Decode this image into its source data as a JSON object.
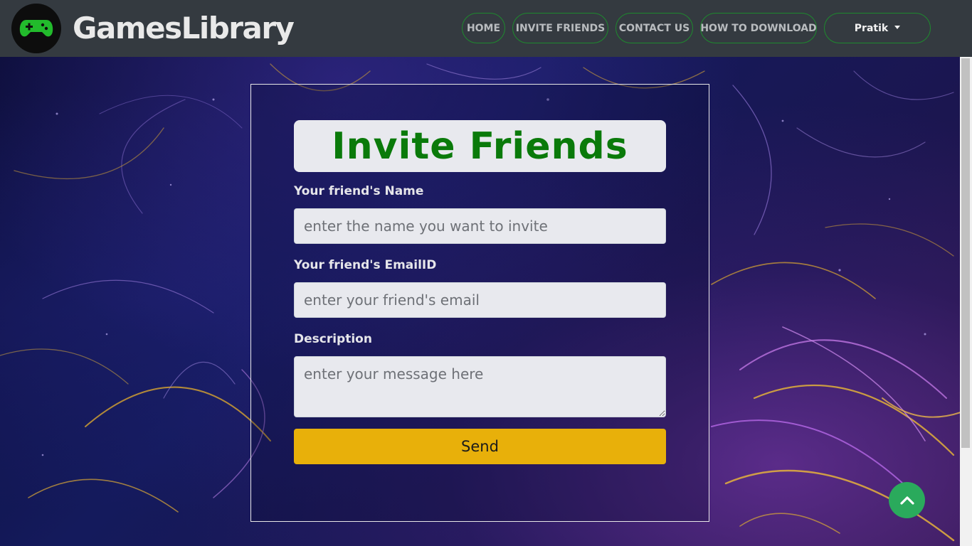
{
  "navbar": {
    "brand": "GamesLibrary",
    "logo_icon": "gamepad-icon",
    "items": [
      {
        "label": "HOME"
      },
      {
        "label": "INVITE FRIENDS"
      },
      {
        "label": "CONTACT US"
      },
      {
        "label": "HOW TO DOWNLOAD"
      }
    ],
    "user": {
      "label": "Pratik",
      "icon": "caret-down-icon"
    }
  },
  "form": {
    "title": "Invite Friends",
    "name": {
      "label": "Your friend's Name",
      "placeholder": "enter the name you want to invite",
      "value": ""
    },
    "email": {
      "label": "Your friend's EmailID",
      "placeholder": "enter your friend's email",
      "value": ""
    },
    "description": {
      "label": "Description",
      "placeholder": "enter your message here",
      "value": ""
    },
    "submit_label": "Send"
  },
  "scroll_top": {
    "icon": "chevron-up-icon"
  },
  "colors": {
    "navbar_bg": "#343a40",
    "nav_border": "#1e8a2e",
    "title_green": "#0a7a0a",
    "send_button": "#e8b00a",
    "scroll_top_button": "#2aaa5c"
  }
}
